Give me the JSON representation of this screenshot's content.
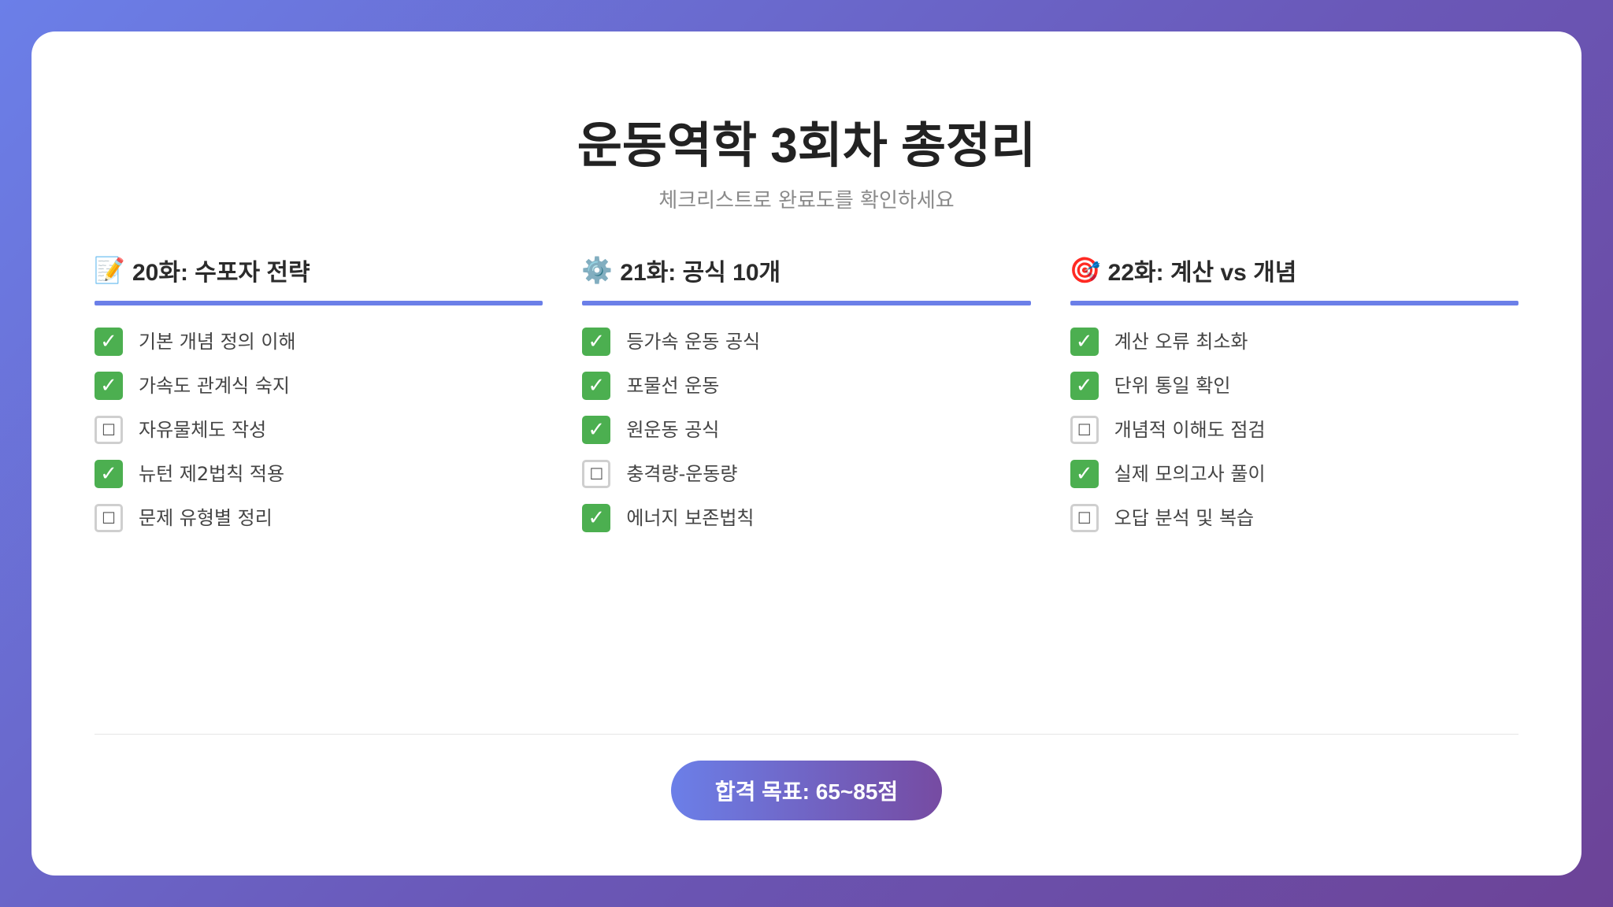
{
  "header": {
    "title": "운동역학 3회차 총정리",
    "subtitle": "체크리스트로 완료도를 확인하세요"
  },
  "columns": [
    {
      "icon": "memo-icon",
      "emoji": "📝",
      "title": "20화: 수포자 전략",
      "items": [
        {
          "label": "기본 개념 정의 이해",
          "checked": true
        },
        {
          "label": "가속도 관계식 숙지",
          "checked": true
        },
        {
          "label": "자유물체도 작성",
          "checked": false
        },
        {
          "label": "뉴턴 제2법칙 적용",
          "checked": true
        },
        {
          "label": "문제 유형별 정리",
          "checked": false
        }
      ]
    },
    {
      "icon": "gear-icon",
      "emoji": "⚙️",
      "title": "21화: 공식 10개",
      "items": [
        {
          "label": "등가속 운동 공식",
          "checked": true
        },
        {
          "label": "포물선 운동",
          "checked": true
        },
        {
          "label": "원운동 공식",
          "checked": true
        },
        {
          "label": "충격량-운동량",
          "checked": false
        },
        {
          "label": "에너지 보존법칙",
          "checked": true
        }
      ]
    },
    {
      "icon": "target-icon",
      "emoji": "🎯",
      "title": "22화: 계산 vs 개념",
      "items": [
        {
          "label": "계산 오류 최소화",
          "checked": true
        },
        {
          "label": "단위 통일 확인",
          "checked": true
        },
        {
          "label": "개념적 이해도 점검",
          "checked": false
        },
        {
          "label": "실제 모의고사 풀이",
          "checked": true
        },
        {
          "label": "오답 분석 및 복습",
          "checked": false
        }
      ]
    }
  ],
  "symbols": {
    "checked": "✓",
    "unchecked": "☐"
  },
  "colors": {
    "accent": "#6b7fe8",
    "checked": "#4caf50",
    "goal_start": "#6b7fe8",
    "goal_end": "#764ba2"
  },
  "footer": {
    "goal_label": "합격 목표: 65~85점"
  }
}
